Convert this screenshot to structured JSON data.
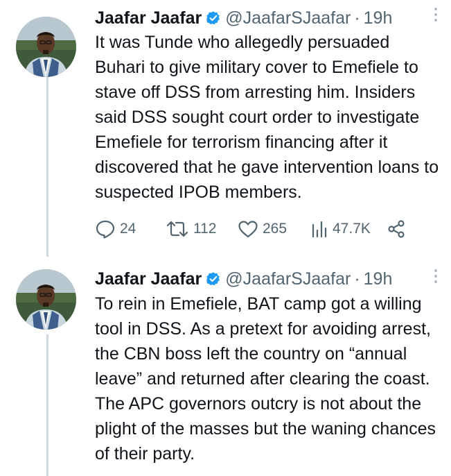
{
  "tweets": [
    {
      "author_name": "Jaafar Jaafar",
      "handle": "@JaafarSJaafar",
      "separator": "·",
      "time": "19h",
      "verified": true,
      "avatar": "avatar-man-outdoor",
      "text": "It was Tunde who allegedly persuaded Buhari to give military cover to Emefiele to stave off DSS from arresting him. Insiders said DSS sought court order to investigate Emefiele for terrorism financing after it discovered that he gave intervention loans to suspected IPOB members.",
      "stats": {
        "replies": "24",
        "retweets": "112",
        "likes": "265",
        "views": "47.7K"
      }
    },
    {
      "author_name": "Jaafar Jaafar",
      "handle": "@JaafarSJaafar",
      "separator": "·",
      "time": "19h",
      "verified": true,
      "avatar": "avatar-man-outdoor",
      "text": "To rein in Emefiele, BAT camp got a willing tool in DSS. As a pretext for avoiding arrest, the CBN boss left the country on “annual leave” and returned after clearing the coast. The APC governors outcry is not about the plight of the masses but the waning chances of their party."
    }
  ],
  "icons": {
    "reply": "reply-icon",
    "retweet": "retweet-icon",
    "like": "heart-icon",
    "views": "views-icon",
    "share": "share-icon",
    "more": "more-icon",
    "verified": "verified-badge-icon"
  },
  "colors": {
    "text": "#0f1419",
    "secondary": "#536471",
    "verified": "#1d9bf0",
    "thread_line": "#cfd9de"
  }
}
